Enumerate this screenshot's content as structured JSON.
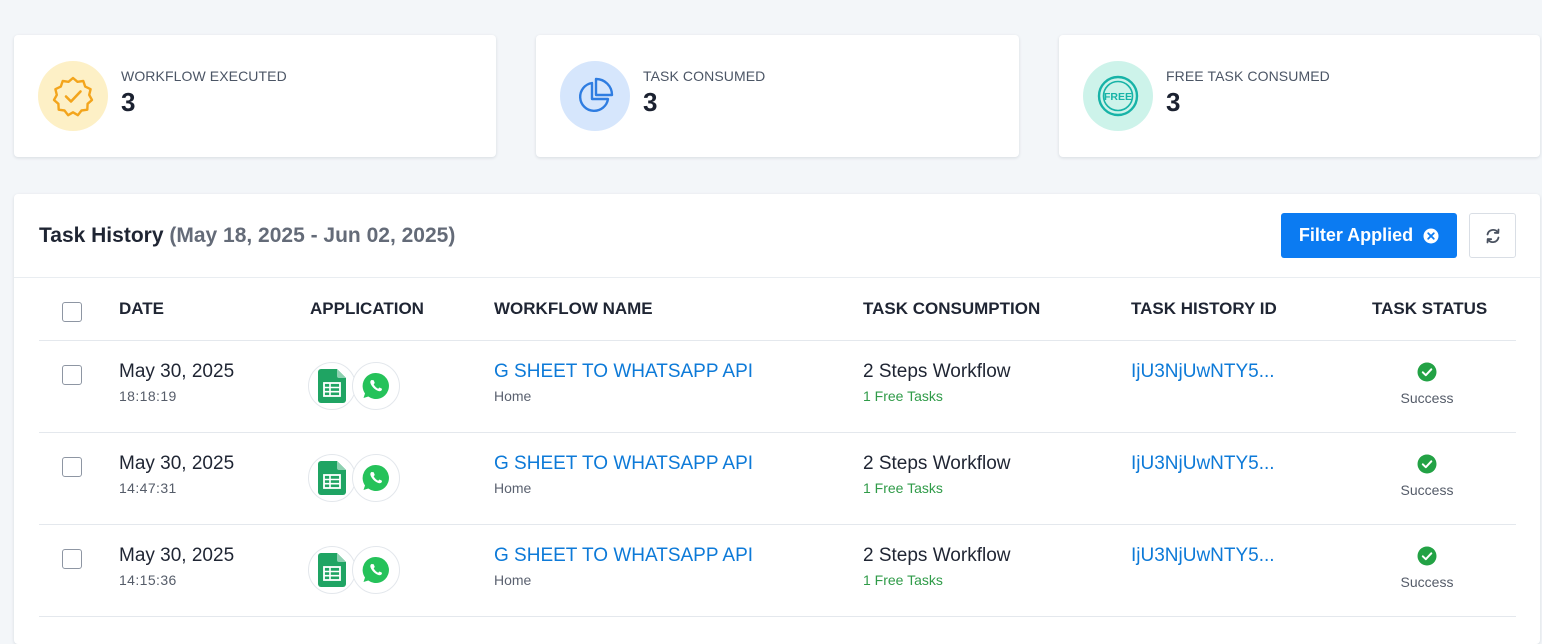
{
  "stats": [
    {
      "label": "WORKFLOW EXECUTED",
      "value": "3",
      "icon": "verified-badge-icon",
      "bg": "#fdf0c6",
      "color": "#f3a51c"
    },
    {
      "label": "TASK CONSUMED",
      "value": "3",
      "icon": "pie-chart-icon",
      "bg": "#d6e6fc",
      "color": "#2f7de1"
    },
    {
      "label": "FREE TASK CONSUMED",
      "value": "3",
      "icon": "free-badge-icon",
      "bg": "#cdf3ea",
      "color": "#17b3a7"
    }
  ],
  "task_history": {
    "title": "Task History",
    "range": "(May 18, 2025 - Jun 02, 2025)",
    "filter_label": "Filter Applied",
    "columns": [
      "DATE",
      "APPLICATION",
      "WORKFLOW NAME",
      "TASK CONSUMPTION",
      "TASK HISTORY ID",
      "TASK STATUS"
    ],
    "rows": [
      {
        "date": "May 30, 2025",
        "time": "18:18:19",
        "apps": [
          "google-sheets-icon",
          "whatsapp-icon"
        ],
        "workflow": "G SHEET TO WHATSAPP API",
        "folder": "Home",
        "consumption": "2 Steps Workflow",
        "free_tasks": "1 Free Tasks",
        "history_id": "IjU3NjUwNTY5...",
        "status": "Success"
      },
      {
        "date": "May 30, 2025",
        "time": "14:47:31",
        "apps": [
          "google-sheets-icon",
          "whatsapp-icon"
        ],
        "workflow": "G SHEET TO WHATSAPP API",
        "folder": "Home",
        "consumption": "2 Steps Workflow",
        "free_tasks": "1 Free Tasks",
        "history_id": "IjU3NjUwNTY5...",
        "status": "Success"
      },
      {
        "date": "May 30, 2025",
        "time": "14:15:36",
        "apps": [
          "google-sheets-icon",
          "whatsapp-icon"
        ],
        "workflow": "G SHEET TO WHATSAPP API",
        "folder": "Home",
        "consumption": "2 Steps Workflow",
        "free_tasks": "1 Free Tasks",
        "history_id": "IjU3NjUwNTY5...",
        "status": "Success"
      }
    ]
  },
  "colors": {
    "accent": "#0b7bf2",
    "link": "#0d7ad8",
    "success": "#2f9b48"
  }
}
